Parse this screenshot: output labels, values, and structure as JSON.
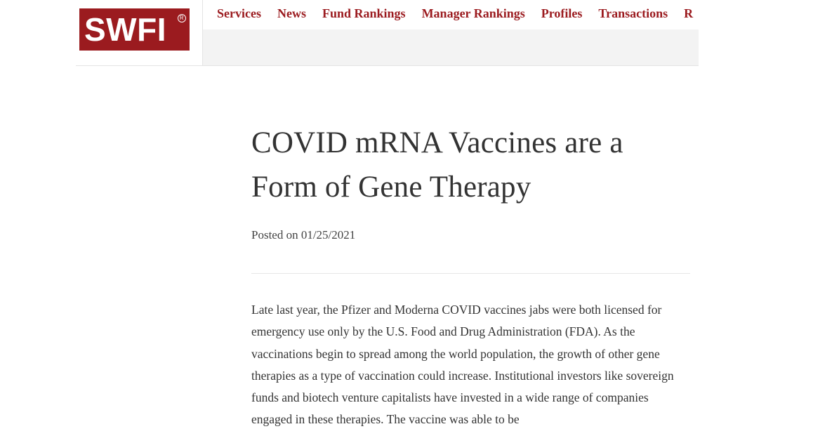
{
  "brand": {
    "logo_text": "SWFI",
    "registered_mark": "R",
    "brand_color": "#9b1b1f"
  },
  "nav": {
    "items": [
      {
        "label": "Services"
      },
      {
        "label": "News"
      },
      {
        "label": "Fund Rankings"
      },
      {
        "label": "Manager Rankings"
      },
      {
        "label": "Profiles"
      },
      {
        "label": "Transactions"
      },
      {
        "label": "R"
      }
    ]
  },
  "article": {
    "title": "COVID mRNA Vaccines are a Form of Gene Therapy",
    "posted": "Posted on 01/25/2021",
    "body": "Late last year, the Pfizer and Moderna COVID vaccines jabs were both licensed for emergency use only by the U.S. Food and Drug Administration (FDA). As the vaccinations begin to spread among the world population, the growth of other gene therapies as a type of vaccination could increase. Institutional investors like sovereign funds and biotech venture capitalists have invested in a wide range of companies engaged in these therapies. The vaccine was able to be"
  }
}
